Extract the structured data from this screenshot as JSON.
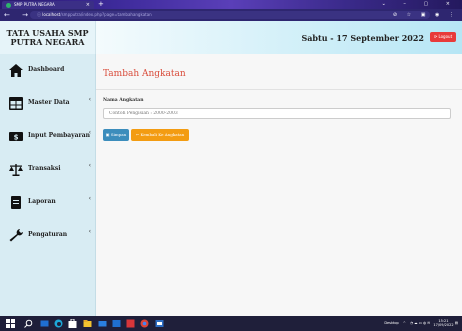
{
  "browser": {
    "tab_title": "SMP PUTRA NEGARA",
    "tab_close": "×",
    "new_tab": "+",
    "window_controls": "⌄ – ▢ ×",
    "nav_buttons": "← → C",
    "url_host": "localhost",
    "url_path": "/smpputra/index.php?page=tambahangkatan",
    "toolbar_icons": "⊘ ☆ ▣ ◉ ⋮"
  },
  "header": {
    "brand": "TATA USAHA SMP PUTRA NEGARA",
    "date": "Sabtu - 17 September 2022",
    "logout_label": "⟳ Logout"
  },
  "sidebar": {
    "items": [
      {
        "label": "Dashboard",
        "icon": "home-icon",
        "has_submenu": false
      },
      {
        "label": "Master Data",
        "icon": "table-icon",
        "has_submenu": true
      },
      {
        "label": "Input Pembayaran",
        "icon": "money-icon",
        "has_submenu": true
      },
      {
        "label": "Transaksi",
        "icon": "balance-icon",
        "has_submenu": true
      },
      {
        "label": "Laporan",
        "icon": "file-icon",
        "has_submenu": true
      },
      {
        "label": "Pengaturan",
        "icon": "wrench-icon",
        "has_submenu": true
      }
    ],
    "chevron": "‹"
  },
  "content": {
    "title": "Tambah Angkatan",
    "field_label": "Nama Angkatan",
    "field_placeholder": "Contoh Pengisian : 2000-2003",
    "save_label": "Simpan",
    "back_label": "Kembali Ke Angkatan"
  },
  "taskbar": {
    "desktop_label": "Desktop",
    "tray_arrow": "^",
    "time": "15:21",
    "date": "17/09/2022"
  },
  "colors": {
    "accent_red": "#e83a3a",
    "title_red": "#d94c3b",
    "save_blue": "#3c8dbc",
    "back_orange": "#f39c12",
    "sidebar_bg": "#d8ecf3",
    "taskbar_bg": "#1f1f3a"
  }
}
